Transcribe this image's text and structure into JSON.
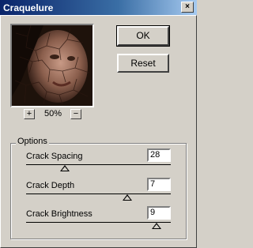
{
  "window": {
    "title": "Craquelure",
    "close_glyph": "×"
  },
  "buttons": {
    "ok": "OK",
    "reset": "Reset"
  },
  "preview": {
    "zoom_in": "+",
    "zoom_out": "−",
    "zoom_level": "50%"
  },
  "options": {
    "group_label": "Options",
    "controls": [
      {
        "label": "Crack Spacing",
        "value": "28",
        "slider_fraction": 0.27
      },
      {
        "label": "Crack Depth",
        "value": "7",
        "slider_fraction": 0.7
      },
      {
        "label": "Crack Brightness",
        "value": "9",
        "slider_fraction": 0.9
      }
    ]
  }
}
